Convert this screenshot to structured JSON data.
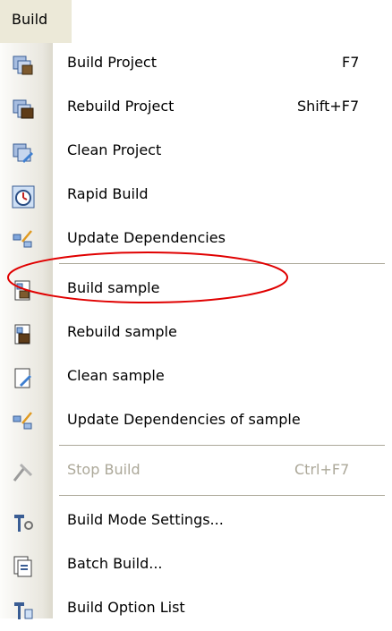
{
  "menu_title": "Build",
  "items": [
    {
      "label": "Build Project",
      "shortcut": "F7",
      "icon": "build-project-icon",
      "enabled": true
    },
    {
      "label": "Rebuild Project",
      "shortcut": "Shift+F7",
      "icon": "rebuild-project-icon",
      "enabled": true
    },
    {
      "label": "Clean Project",
      "shortcut": "",
      "icon": "clean-project-icon",
      "enabled": true
    },
    {
      "label": "Rapid Build",
      "shortcut": "",
      "icon": "rapid-build-icon",
      "enabled": true
    },
    {
      "label": "Update Dependencies",
      "shortcut": "",
      "icon": "update-dependencies-icon",
      "enabled": true
    },
    {
      "label": "Build sample",
      "shortcut": "",
      "icon": "build-sample-icon",
      "enabled": true
    },
    {
      "label": "Rebuild sample",
      "shortcut": "",
      "icon": "rebuild-sample-icon",
      "enabled": true
    },
    {
      "label": "Clean sample",
      "shortcut": "",
      "icon": "clean-sample-icon",
      "enabled": true
    },
    {
      "label": "Update Dependencies of sample",
      "shortcut": "",
      "icon": "update-dependencies-sample-icon",
      "enabled": true
    },
    {
      "label": "Stop Build",
      "shortcut": "Ctrl+F7",
      "icon": "stop-build-icon",
      "enabled": false
    },
    {
      "label": "Build Mode Settings...",
      "shortcut": "",
      "icon": "build-mode-settings-icon",
      "enabled": true
    },
    {
      "label": "Batch Build...",
      "shortcut": "",
      "icon": "batch-build-icon",
      "enabled": true
    },
    {
      "label": "Build Option List",
      "shortcut": "",
      "icon": "build-option-list-icon",
      "enabled": true
    }
  ],
  "highlighted_item": "Update Dependencies",
  "colors": {
    "menu_bar": "#ece9d8",
    "icon_strip": "#e9e7df",
    "disabled_text": "#aca899",
    "highlight_ellipse": "#e00000"
  }
}
